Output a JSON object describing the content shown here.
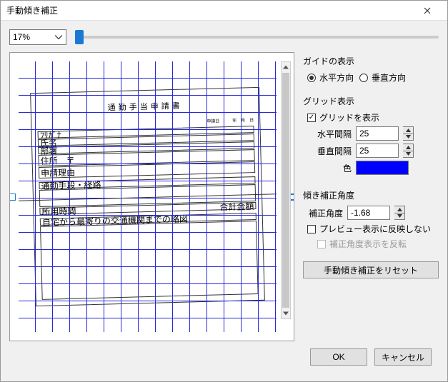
{
  "title": "手動傾き補正",
  "zoom": "17%",
  "guide": {
    "header": "ガイドの表示",
    "horiz": "水平方向",
    "vert": "垂直方向",
    "selected": "horiz"
  },
  "grid": {
    "header": "グリッド表示",
    "show_label": "グリッドを表示",
    "show": true,
    "h_label": "水平間隔",
    "h_value": "25",
    "v_label": "垂直間隔",
    "v_value": "25",
    "color_label": "色",
    "color": "#0000ff"
  },
  "angle": {
    "header": "傾き補正角度",
    "label": "補正角度",
    "value": "-1.68",
    "no_preview_label": "プレビュー表示に反映しない",
    "no_preview": false,
    "invert_label": "補正角度表示を反転",
    "invert": false
  },
  "reset_label": "手動傾き補正をリセット",
  "ok": "OK",
  "cancel": "キャンセル",
  "doc": {
    "title": "通勤手当申請書",
    "date_lbl": "申請日　　　年　月　日",
    "f1": "ﾌﾘｶﾞﾅ",
    "f2": "氏名",
    "f3": "部署",
    "f4": "住所　〒",
    "f5": "申請理由",
    "f6": "通勤手段・経路",
    "f7": "",
    "f8": "所用時間",
    "f9": "合計金額",
    "f10": "自宅から最寄りの交通機関までの略図"
  }
}
